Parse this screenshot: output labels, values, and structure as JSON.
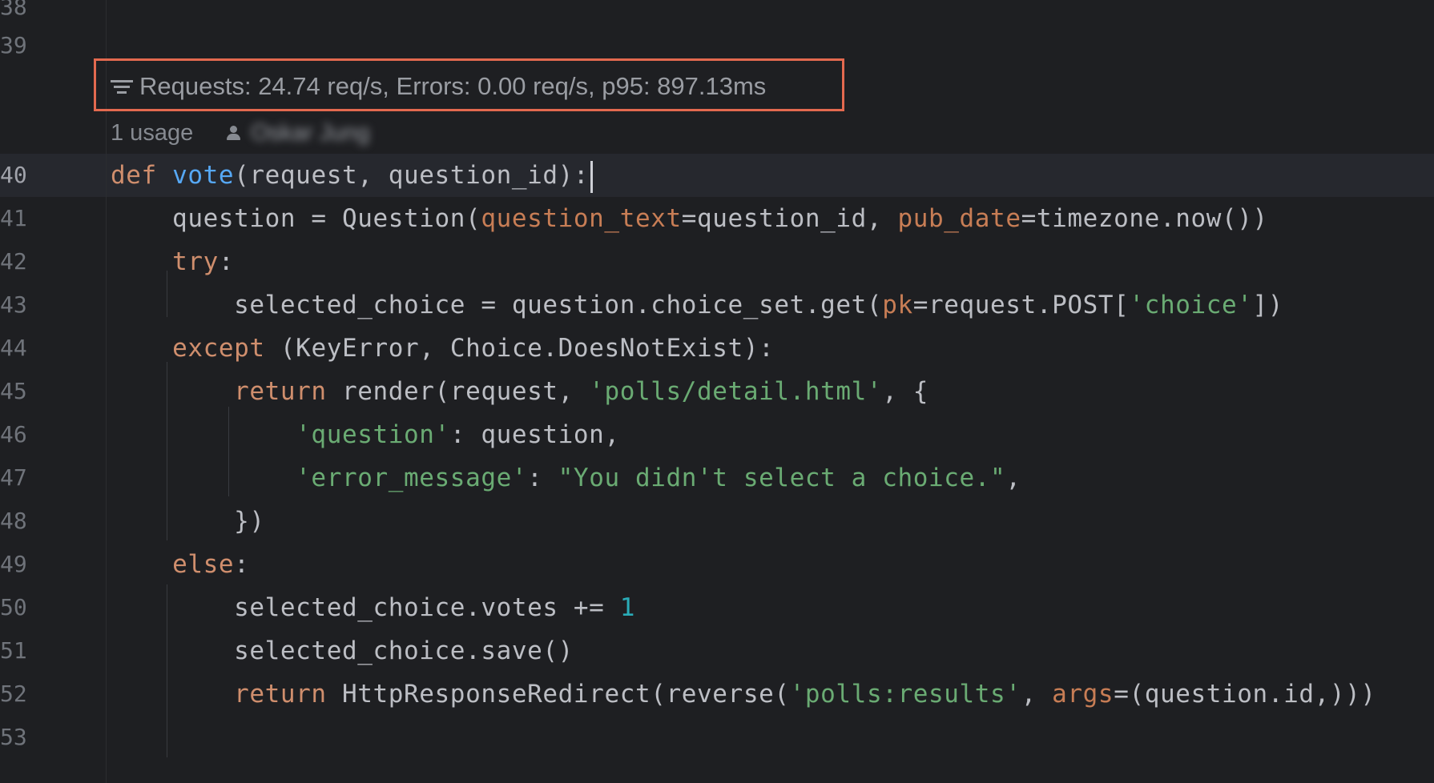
{
  "gutter": {
    "line_numbers": [
      "38",
      "39",
      "40",
      "41",
      "42",
      "43",
      "44",
      "45",
      "46",
      "47",
      "48",
      "49",
      "50",
      "51",
      "52",
      "53"
    ],
    "current_line": "40"
  },
  "inlay": {
    "metrics_text": "Requests: 24.74 req/s, Errors: 0.00 req/s, p95: 897.13ms",
    "metrics_icon": "filter-lines-icon",
    "highlight_color": "#e3694f",
    "usages": "1 usage",
    "author_icon": "person-icon",
    "author": "Oskar Jung"
  },
  "code": {
    "lines": [
      [
        {
          "t": "def",
          "c": "kw"
        },
        {
          "t": " "
        },
        {
          "t": "vote",
          "c": "fn"
        },
        {
          "t": "(request, question_id):"
        }
      ],
      [
        {
          "t": "    question = Question("
        },
        {
          "t": "question_text",
          "c": "param"
        },
        {
          "t": "=question_id, "
        },
        {
          "t": "pub_date",
          "c": "param"
        },
        {
          "t": "=timezone.now())"
        }
      ],
      [
        {
          "t": "    "
        },
        {
          "t": "try",
          "c": "kw"
        },
        {
          "t": ":"
        }
      ],
      [
        {
          "t": "        selected_choice = question.choice_set.get("
        },
        {
          "t": "pk",
          "c": "param"
        },
        {
          "t": "=request.POST["
        },
        {
          "t": "'choice'",
          "c": "str"
        },
        {
          "t": "])"
        }
      ],
      [
        {
          "t": "    "
        },
        {
          "t": "except",
          "c": "kw"
        },
        {
          "t": " (KeyError, Choice.DoesNotExist):"
        }
      ],
      [
        {
          "t": "        "
        },
        {
          "t": "return",
          "c": "kw"
        },
        {
          "t": " render(request, "
        },
        {
          "t": "'polls/detail.html'",
          "c": "str"
        },
        {
          "t": ", {"
        }
      ],
      [
        {
          "t": "            "
        },
        {
          "t": "'question'",
          "c": "str"
        },
        {
          "t": ": question,"
        }
      ],
      [
        {
          "t": "            "
        },
        {
          "t": "'error_message'",
          "c": "str"
        },
        {
          "t": ": "
        },
        {
          "t": "\"You didn't select a choice.\"",
          "c": "str"
        },
        {
          "t": ","
        }
      ],
      [
        {
          "t": "        })"
        }
      ],
      [
        {
          "t": "    "
        },
        {
          "t": "else",
          "c": "kw"
        },
        {
          "t": ":"
        }
      ],
      [
        {
          "t": "        selected_choice.votes += "
        },
        {
          "t": "1",
          "c": "num"
        }
      ],
      [
        {
          "t": "        selected_choice.save()"
        }
      ],
      [
        {
          "t": "        "
        },
        {
          "t": "return",
          "c": "kw"
        },
        {
          "t": " HttpResponseRedirect(reverse("
        },
        {
          "t": "'polls:results'",
          "c": "str"
        },
        {
          "t": ", "
        },
        {
          "t": "args",
          "c": "param"
        },
        {
          "t": "=(question.id,)))"
        }
      ],
      []
    ]
  },
  "colors": {
    "background": "#1e1f22",
    "keyword": "#cf8e6d",
    "function": "#56a8f5",
    "parameter": "#c77d55",
    "string": "#6aab73",
    "number": "#2aacb8",
    "text": "#bcbec4"
  }
}
